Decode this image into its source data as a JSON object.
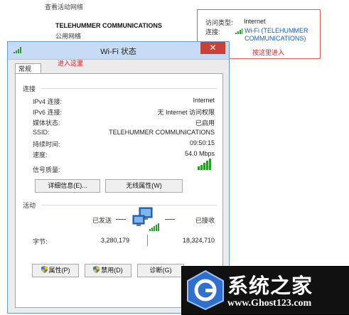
{
  "network_panel": {
    "header": "查看活动网络",
    "network_name": "TELEHUMMER COMMUNICATIONS",
    "network_type": "公用网络",
    "access_type_label": "访问类型:",
    "access_type_value": "Internet",
    "connection_label": "连接:",
    "connection_link_line1": "Wi-Fi (TELEHUMMER",
    "connection_link_line2": "COMMUNICATIONS)",
    "click_here_note": "按这里进入"
  },
  "dialog": {
    "title": "Wi-Fi 状态",
    "enter_here_note": "进入这里",
    "tab": "常规",
    "connection_section": "连接",
    "rows": [
      {
        "label": "IPv4 连接:",
        "value": "Internet"
      },
      {
        "label": "IPv6 连接:",
        "value": "无 Internet 访问权限"
      },
      {
        "label": "媒体状态:",
        "value": "已启用"
      },
      {
        "label": "SSID:",
        "value": "TELEHUMMER COMMUNICATIONS"
      },
      {
        "label": "持续时间:",
        "value": "09:50:15"
      },
      {
        "label": "速度:",
        "value": "54.0 Mbps"
      }
    ],
    "signal_label": "信号质量:",
    "details_button": "详细信息(E)...",
    "wireless_props_button": "无线属性(W)",
    "activity_section": "活动",
    "sent_label": "已发送",
    "received_label": "已接收",
    "bytes_label": "字节:",
    "bytes_sent": "3,280,179",
    "bytes_received": "18,324,710",
    "properties_button": "属性(P)",
    "disable_button": "禁用(D)",
    "diagnose_button": "诊断(G)",
    "close_glyph": "✕"
  },
  "watermark": {
    "title": "系统之家",
    "url": "www.Ghost123.com"
  },
  "colors": {
    "accent_link": "#1b5fbd",
    "annotation_red": "#dd2222",
    "close_red": "#c7433a",
    "signal_green": "#2e9a2e"
  }
}
